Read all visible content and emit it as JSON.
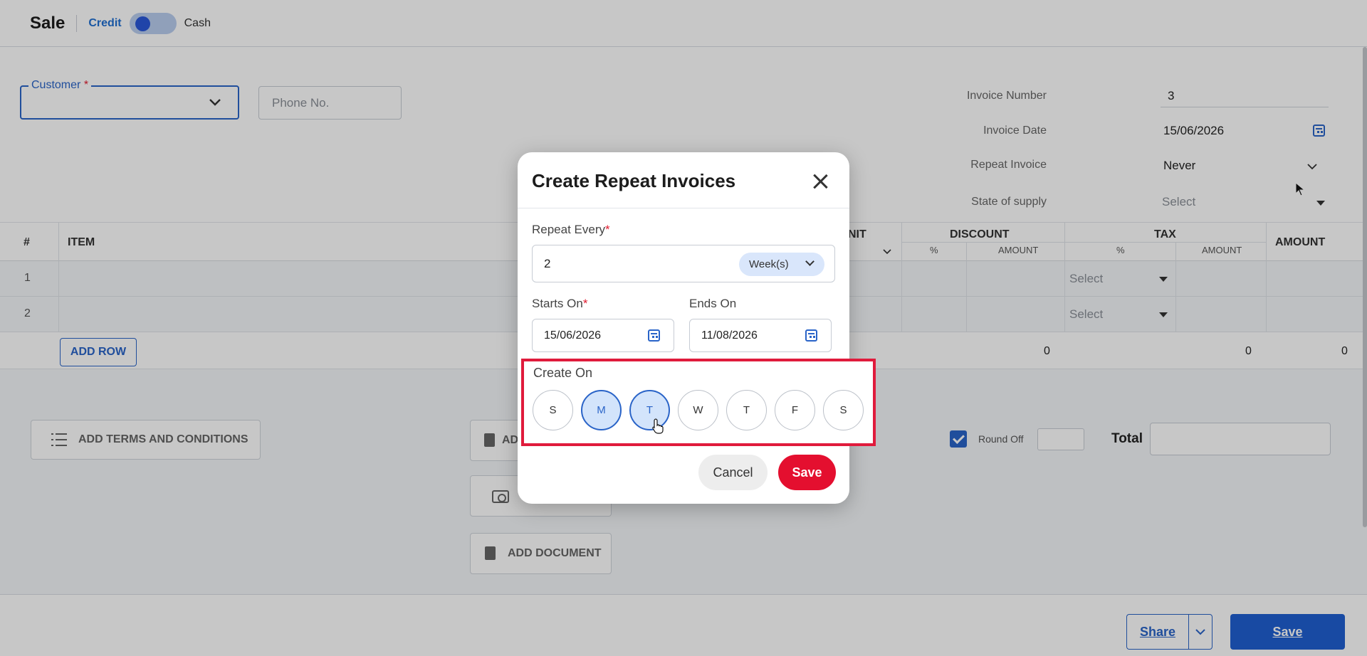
{
  "header": {
    "title": "Sale",
    "credit_label": "Credit",
    "cash_label": "Cash"
  },
  "form": {
    "customer_label": "Customer",
    "required_mark": "*",
    "phone_placeholder": "Phone No.",
    "invoice_number_label": "Invoice Number",
    "invoice_number_value": "3",
    "invoice_date_label": "Invoice Date",
    "invoice_date_value": "15/06/2026",
    "repeat_invoice_label": "Repeat Invoice",
    "repeat_invoice_value": "Never",
    "state_label": "State of supply",
    "state_value": "Select"
  },
  "table": {
    "headers": {
      "num": "#",
      "item": "ITEM",
      "unit": "NIT",
      "discount": "DISCOUNT",
      "tax": "TAX",
      "amount": "AMOUNT"
    },
    "subheaders": {
      "disc_pct": "%",
      "disc_amt": "AMOUNT",
      "tax_pct": "%",
      "tax_amt": "AMOUNT"
    },
    "rows": [
      {
        "num": "1",
        "tax_select": "Select"
      },
      {
        "num": "2",
        "tax_select": "Select"
      }
    ],
    "add_row_label": "ADD ROW",
    "totals": {
      "discount": "0",
      "tax": "0",
      "amount": "0"
    }
  },
  "lower": {
    "terms_label": "ADD TERMS AND CONDITIONS",
    "add_description_label": "AD",
    "add_document_label": "ADD DOCUMENT",
    "round_off_label": "Round Off",
    "total_label": "Total"
  },
  "footer": {
    "share_label": "Share",
    "save_label": "Save"
  },
  "modal": {
    "title": "Create Repeat Invoices",
    "repeat_every_label": "Repeat Every",
    "repeat_every_value": "2",
    "repeat_unit": "Week(s)",
    "starts_on_label": "Starts On",
    "starts_on_value": "15/06/2026",
    "ends_on_label": "Ends On",
    "ends_on_value": "11/08/2026",
    "create_on_label": "Create On",
    "days": [
      {
        "label": "S",
        "selected": false
      },
      {
        "label": "M",
        "selected": true
      },
      {
        "label": "T",
        "selected": true
      },
      {
        "label": "W",
        "selected": false
      },
      {
        "label": "T",
        "selected": false
      },
      {
        "label": "F",
        "selected": false
      },
      {
        "label": "S",
        "selected": false
      }
    ],
    "cancel_label": "Cancel",
    "save_label": "Save"
  },
  "colors": {
    "accent_blue": "#2a64c8",
    "save_red": "#e40f2f",
    "highlight_red": "#e01b3c"
  }
}
